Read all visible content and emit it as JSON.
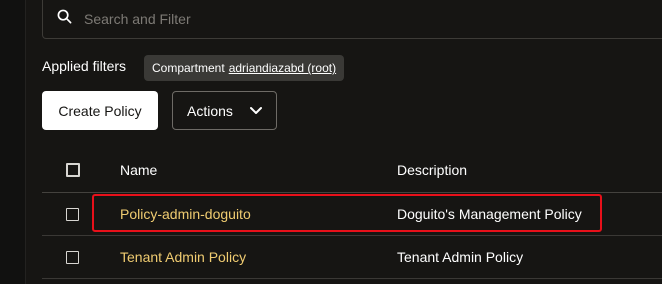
{
  "search": {
    "placeholder": "Search and Filter"
  },
  "filters": {
    "label": "Applied filters",
    "chip_prefix": "Compartment",
    "chip_value": "adriandiazabd (root)"
  },
  "toolbar": {
    "create_label": "Create Policy",
    "actions_label": "Actions"
  },
  "table": {
    "columns": {
      "name": "Name",
      "description": "Description"
    },
    "rows": [
      {
        "name": "Policy-admin-doguito",
        "description": "Doguito's Management Policy"
      },
      {
        "name": "Tenant Admin Policy",
        "description": "Tenant Admin Policy"
      }
    ]
  },
  "colors": {
    "background": "#161513",
    "link": "#f0cc71",
    "highlight": "#e8101a"
  }
}
